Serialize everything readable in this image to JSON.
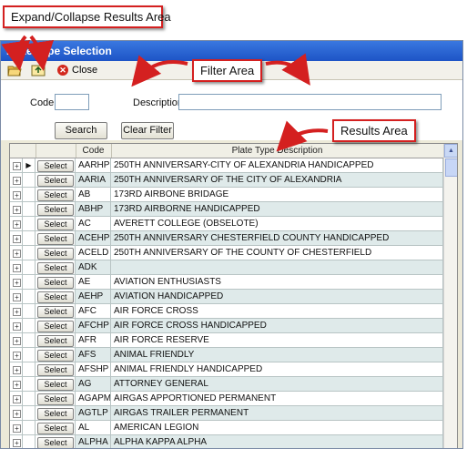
{
  "callouts": {
    "expand": "Expand/Collapse Results Area",
    "filter": "Filter Area",
    "results": "Results Area"
  },
  "window": {
    "title": "Plate Type Selection"
  },
  "toolbar": {
    "expand_icon": "folder-open-icon",
    "collapse_icon": "folder-up-icon",
    "close_label": "Close",
    "close_icon": "close-icon"
  },
  "filter": {
    "code_label": "Code",
    "code_value": "",
    "description_label": "Description",
    "description_value": "",
    "search_label": "Search",
    "clear_label": "Clear Filter"
  },
  "grid": {
    "columns": [
      "Code",
      "Plate Type Description"
    ],
    "select_label": "Select",
    "rows": [
      {
        "code": "AARHP",
        "desc": "250TH ANNIVERSARY-CITY OF ALEXANDRIA HANDICAPPED"
      },
      {
        "code": "AARIA",
        "desc": "250TH ANNIVERSARY OF THE CITY OF ALEXANDRIA"
      },
      {
        "code": "AB",
        "desc": "173RD AIRBONE BRIDAGE"
      },
      {
        "code": "ABHP",
        "desc": "173RD AIRBORNE HANDICAPPED"
      },
      {
        "code": "AC",
        "desc": "AVERETT COLLEGE (OBSELOTE)"
      },
      {
        "code": "ACEHP",
        "desc": "250TH ANNIVERSARY  CHESTERFIELD COUNTY HANDICAPPED"
      },
      {
        "code": "ACELD",
        "desc": "250TH ANNIVERSARY OF THE COUNTY OF CHESTERFIELD"
      },
      {
        "code": "ADK",
        "desc": ""
      },
      {
        "code": "AE",
        "desc": "AVIATION ENTHUSIASTS"
      },
      {
        "code": "AEHP",
        "desc": "AVIATION HANDICAPPED"
      },
      {
        "code": "AFC",
        "desc": "AIR FORCE CROSS"
      },
      {
        "code": "AFCHP",
        "desc": "AIR FORCE CROSS HANDICAPPED"
      },
      {
        "code": "AFR",
        "desc": "AIR FORCE RESERVE"
      },
      {
        "code": "AFS",
        "desc": "ANIMAL FRIENDLY"
      },
      {
        "code": "AFSHP",
        "desc": "ANIMAL FRIENDLY HANDICAPPED"
      },
      {
        "code": "AG",
        "desc": "ATTORNEY GENERAL"
      },
      {
        "code": "AGAPM",
        "desc": "AIRGAS APPORTIONED PERMANENT"
      },
      {
        "code": "AGTLP",
        "desc": "AIRGAS TRAILER PERMANENT"
      },
      {
        "code": "AL",
        "desc": "AMERICAN LEGION"
      },
      {
        "code": "ALPHA",
        "desc": "ALPHA KAPPA ALPHA"
      }
    ]
  },
  "colors": {
    "callout_border": "#d42020",
    "arrow": "#d42020",
    "titlebar": "#2a63d6",
    "row_alt": "#dfeaea"
  }
}
